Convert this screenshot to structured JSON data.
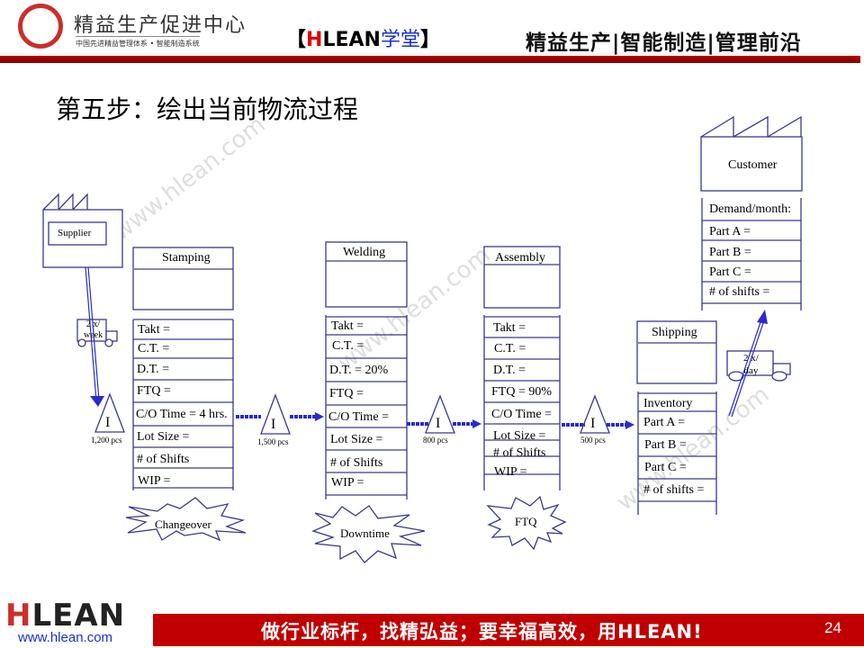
{
  "header": {
    "org_name": "精益生产促进中心",
    "org_subtitle": "中国先进精益管理体系 • 智能制造系统",
    "brand_open": "【",
    "brand_h": "H",
    "brand_rest": "LEAN",
    "brand_cn": "学堂",
    "brand_close": "】",
    "slogan": "精益生产|智能制造|管理前沿"
  },
  "page_title": "第五步：绘出当前物流过程",
  "watermark": "www.hlean.com",
  "supplier": {
    "label": "Supplier"
  },
  "supplier_truck": {
    "line1": "2 x/",
    "line2": "week"
  },
  "customer": {
    "label": "Customer",
    "rows": [
      "Demand/month:",
      "Part A =",
      "Part B =",
      "Part C =",
      "# of shifts ="
    ]
  },
  "customer_truck": {
    "line1": "2 x/",
    "line2": "day"
  },
  "processes": [
    {
      "name": "Stamping",
      "rows": [
        "Takt =",
        "C.T. =",
        "D.T. =",
        "FTQ =",
        "C/O Time = 4 hrs.",
        "Lot Size =",
        "# of Shifts",
        "WIP ="
      ],
      "kaizen": "Changeover"
    },
    {
      "name": "Welding",
      "rows": [
        "Takt =",
        "C.T. =",
        "D.T. = 20%",
        "FTQ =",
        "C/O Time =",
        "Lot Size =",
        "# of Shifts",
        "WIP ="
      ],
      "kaizen": "Downtime"
    },
    {
      "name": "Assembly",
      "rows": [
        "Takt =",
        "C.T. =",
        "D.T. =",
        "FTQ = 90%",
        "C/O Time =",
        "Lot Size =",
        "# of Shifts",
        "WIP ="
      ],
      "kaizen": "FTQ"
    },
    {
      "name": "Shipping",
      "rows": [
        "Inventory",
        "Part A =",
        "Part B =",
        "Part C =",
        "# of shifts ="
      ]
    }
  ],
  "inventories": [
    {
      "symbol": "I",
      "qty": "1,200 pcs"
    },
    {
      "symbol": "I",
      "qty": "1,500 pcs"
    },
    {
      "symbol": "I",
      "qty": "800 pcs"
    },
    {
      "symbol": "I",
      "qty": "500 pcs"
    }
  ],
  "footer": {
    "logo_h": "H",
    "logo_rest": "LEAN",
    "url": "www.hlean.com",
    "slogan": "做行业标杆，找精弘益；要幸福高效，用HLEAN!",
    "page_number": "24"
  },
  "colors": {
    "accent_red": "#c00000",
    "diagram_line": "#3a3a8c",
    "arrow_blue": "#2a2ad0"
  }
}
